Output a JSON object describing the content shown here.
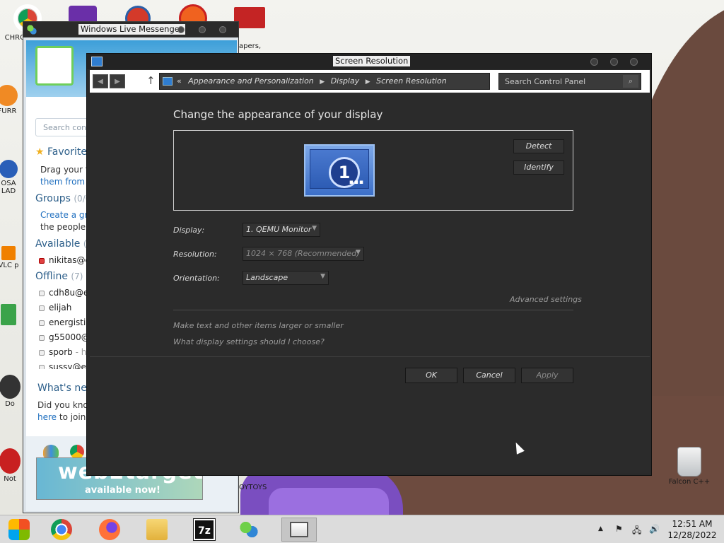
{
  "desktop": {
    "icons": [
      {
        "label": "CHROME D..."
      },
      {
        "label": "FURR"
      },
      {
        "label": "OSA LAD"
      },
      {
        "label": "VLC p"
      },
      {
        "label": "Do"
      },
      {
        "label": "Not"
      }
    ],
    "papers_label": "apers,",
    "toytoys_label": "OYTOYS",
    "recycle_label": "Falcon C++"
  },
  "messenger": {
    "title": "Windows Live Messenger",
    "search_placeholder": "Search cont",
    "favorites": {
      "title": "Favorite",
      "line1": "Drag your fa",
      "line2": "them from y"
    },
    "groups": {
      "title": "Groups",
      "count": "(0/0",
      "link": "Create a gro",
      "line2": "the people y"
    },
    "available": {
      "title": "Available",
      "count": "("
    },
    "available_contacts": [
      {
        "name": "nikitas@e",
        "msg": ""
      }
    ],
    "offline": {
      "title": "Offline",
      "count": "(7)"
    },
    "offline_contacts": [
      {
        "name": "cdh8u@es",
        "msg": ""
      },
      {
        "name": "elijah",
        "msg": ""
      },
      {
        "name": "energistic",
        "msg": ""
      },
      {
        "name": "g55000@c",
        "msg": ""
      },
      {
        "name": "sporb",
        "msg": " - ho"
      },
      {
        "name": "sussy@es",
        "msg": ""
      }
    ],
    "whats_new": {
      "title": "What's ne",
      "line1": "Did you know",
      "link": "here",
      "line2": " to join"
    },
    "ad": {
      "big": "web2target",
      "small": "available now!"
    }
  },
  "window": {
    "title": "Screen Resolution",
    "address": {
      "prefix": "«",
      "crumbs": [
        "Appearance and Personalization",
        "Display",
        "Screen Resolution"
      ]
    },
    "search_placeholder": "Search Control Panel",
    "heading": "Change the appearance of your display",
    "monitor_number": "1",
    "detect_label": "Detect",
    "identify_label": "Identify",
    "display_label": "Display:",
    "display_value": "1. QEMU Monitor",
    "resolution_label": "Resolution:",
    "resolution_value": "1024 × 768 (Recommended)",
    "orientation_label": "Orientation:",
    "orientation_value": "Landscape",
    "advanced_link": "Advanced settings",
    "help_link1": "Make text and other items larger or smaller",
    "help_link2": "What display settings should I choose?",
    "ok_label": "OK",
    "cancel_label": "Cancel",
    "apply_label": "Apply"
  },
  "taskbar": {
    "items": [
      "start",
      "chrome",
      "firefox",
      "explorer",
      "7zip",
      "messenger",
      "control-panel"
    ],
    "time": "12:51 AM",
    "date": "12/28/2022"
  }
}
